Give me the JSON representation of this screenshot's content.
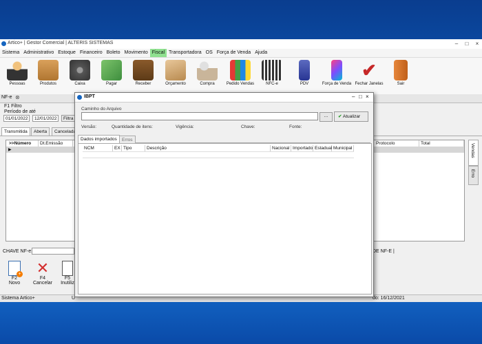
{
  "main": {
    "title": "Artico+ | Gestor Comercial | ALTERIS SISTEMAS",
    "menu": [
      "Sistema",
      "Administrativo",
      "Estoque",
      "Financeiro",
      "Boleto",
      "Movimento",
      "Fiscal",
      "Transportadora",
      "OS",
      "Força de Venda",
      "Ajuda"
    ],
    "active_menu": "Fiscal",
    "toolbar": [
      "Pessoas",
      "Produtos",
      "Caixa",
      "Pagar",
      "Receber",
      "Orçamento",
      "Compra",
      "Pedido Vendas",
      "NFC-e",
      "PDV",
      "Força de Venda",
      "Fechar Janelas",
      "Sair"
    ],
    "doc_tab": "NF-e",
    "filter_title": "F1 Filtro",
    "period_label": "Período de  até",
    "date_from": "01/01/2022",
    "date_to": "12/01/2022",
    "filter_btn": "Filtra",
    "status_tabs": [
      "Transmitida",
      "Aberta",
      "Cancelada"
    ],
    "grid_headers": [
      ">>Número",
      "Dt.Emissão"
    ],
    "grid_headers_right": [
      "Protocolo",
      "Total"
    ],
    "side_tabs": [
      "Vendas",
      "Erro"
    ],
    "chave_label": "CHAVE NF-e:",
    "chave_suffix": "DE NF-E |",
    "bottom_buttons": [
      {
        "key": "F2",
        "label": "Novo"
      },
      {
        "key": "F4",
        "label": "Cancelar"
      },
      {
        "key": "F5",
        "label": "Inutiliz"
      }
    ],
    "status_left": "Sistema Artico+",
    "status_u": "U",
    "status_right": "do: 16/12/2021"
  },
  "dialog": {
    "title": "IBPT",
    "path_label": "Caminho do Arquivo",
    "path_value": "",
    "browse": "...",
    "update_btn": "Atualizar",
    "info_labels": [
      "Versão:",
      "Quantidade de itens:",
      "Vigência:",
      "Chave:",
      "Fonte:"
    ],
    "tabs": [
      "Dados importados",
      "Erros"
    ],
    "columns": [
      "NCM",
      "EX",
      "Tipo",
      "Descrição",
      "Nacional",
      "Importado",
      "Estadual",
      "Municipal"
    ]
  },
  "colors": {
    "menu_active": "#8fe08f",
    "accent_green": "#2e9e2e"
  }
}
